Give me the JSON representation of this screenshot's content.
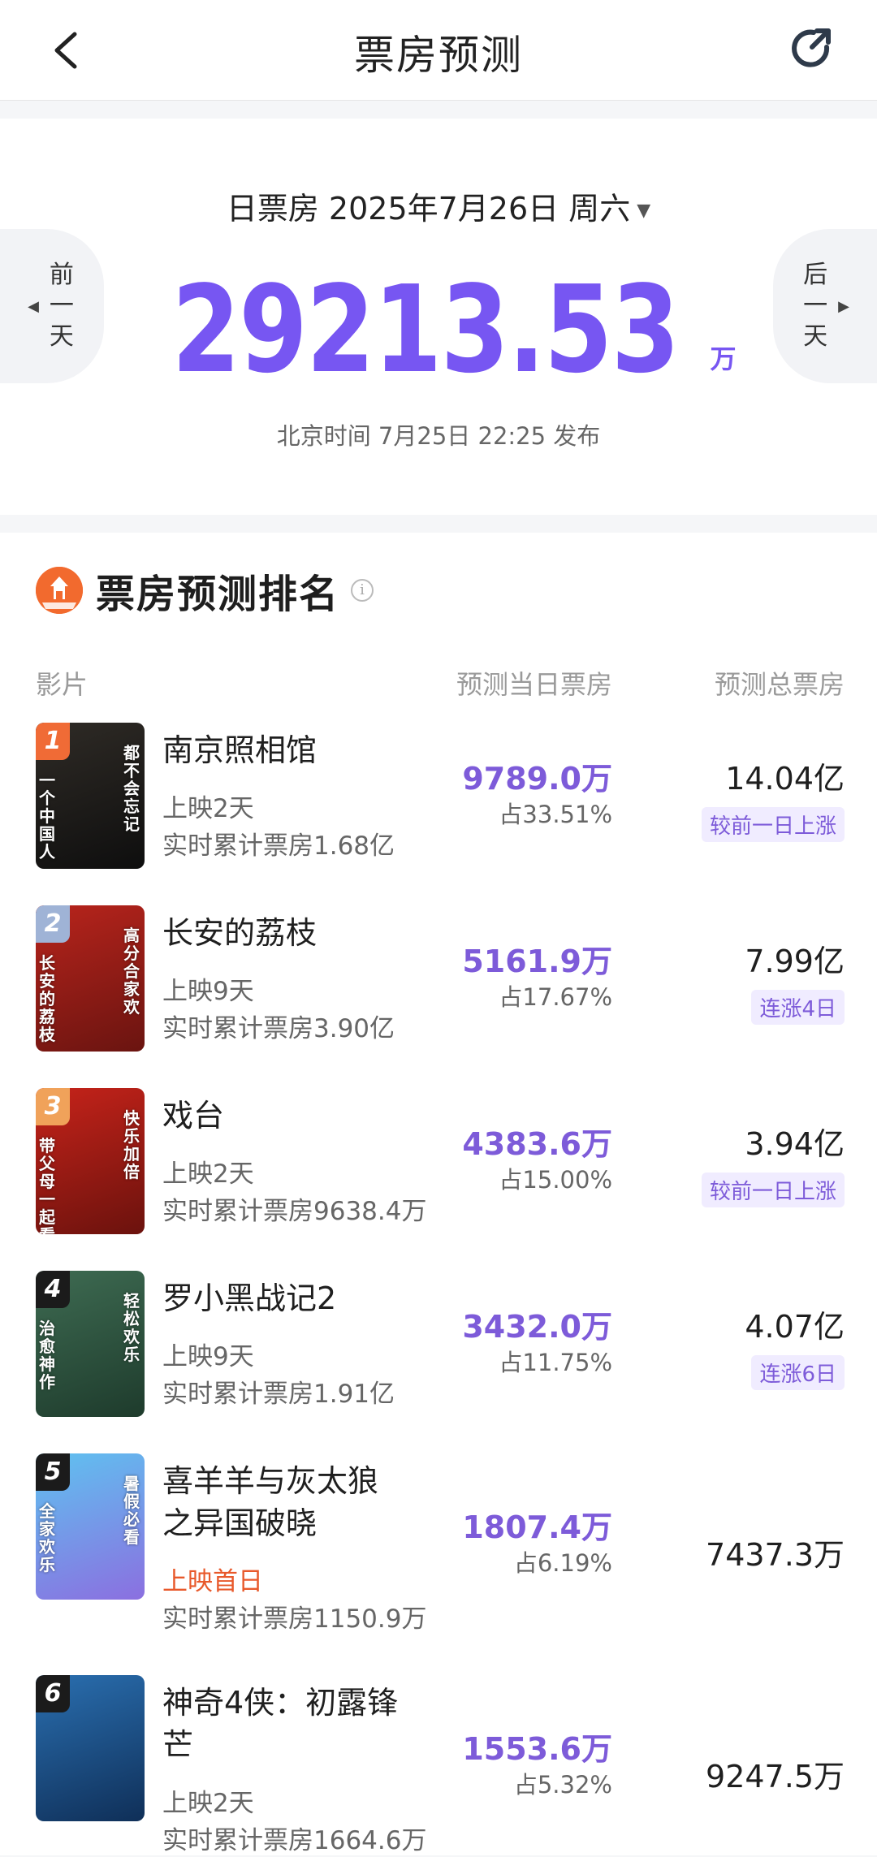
{
  "nav": {
    "title": "票房预测"
  },
  "daily": {
    "heading": "日票房 2025年7月26日 周六",
    "amount": "29213.53",
    "unit": "万",
    "publish": "北京时间 7月25日 22:25 发布",
    "prev_label": [
      "前",
      "一",
      "天"
    ],
    "next_label": [
      "后",
      "一",
      "天"
    ]
  },
  "ranking": {
    "title": "票房预测排名",
    "columns": {
      "film": "影片",
      "daily": "预测当日票房",
      "total": "预测总票房"
    },
    "movies": [
      {
        "rank": "1",
        "title_lines": [
          "南京照相馆"
        ],
        "days": "上映2天",
        "cumulative": "实时累计票房1.68亿",
        "daily": "9789.0万",
        "share": "占33.51%",
        "total": "14.04亿",
        "tag": "较前一日上涨",
        "badge_color": "#f06b36",
        "poster_colors": [
          "#2f2b26",
          "#0e0e0e"
        ],
        "poster_texts": [
          "都不会忘记",
          "一个中国人"
        ]
      },
      {
        "rank": "2",
        "title_lines": [
          "长安的荔枝"
        ],
        "days": "上映9天",
        "cumulative": "实时累计票房3.90亿",
        "daily": "5161.9万",
        "share": "占17.67%",
        "total": "7.99亿",
        "tag": "连涨4日",
        "badge_color": "#9fb3d6",
        "poster_colors": [
          "#b8241c",
          "#6a1410"
        ],
        "poster_texts": [
          "高分合家欢",
          "长安的荔枝"
        ]
      },
      {
        "rank": "3",
        "title_lines": [
          "戏台"
        ],
        "days": "上映2天",
        "cumulative": "实时累计票房9638.4万",
        "daily": "4383.6万",
        "share": "占15.00%",
        "total": "3.94亿",
        "tag": "较前一日上涨",
        "badge_color": "#f0a25a",
        "poster_colors": [
          "#c6231a",
          "#6b120d"
        ],
        "poster_texts": [
          "快乐加倍",
          "带父母一起看"
        ]
      },
      {
        "rank": "4",
        "title_lines": [
          "罗小黑战记2"
        ],
        "days": "上映9天",
        "cumulative": "实时累计票房1.91亿",
        "daily": "3432.0万",
        "share": "占11.75%",
        "total": "4.07亿",
        "tag": "连涨6日",
        "badge_color": "#1b1b1b",
        "poster_colors": [
          "#3e6b52",
          "#1e3b2c"
        ],
        "poster_texts": [
          "轻松欢乐",
          "治愈神作"
        ]
      },
      {
        "rank": "5",
        "title_lines": [
          "喜羊羊与灰太狼",
          "之异国破晓"
        ],
        "days": "上映首日",
        "cumulative": "实时累计票房1150.9万",
        "daily": "1807.4万",
        "share": "占6.19%",
        "total": "7437.3万",
        "tag": "",
        "badge_color": "#1b1b1b",
        "poster_colors": [
          "#5fc2f0",
          "#8b6fe0"
        ],
        "poster_texts": [
          "暑假必看",
          "全家欢乐"
        ]
      },
      {
        "rank": "6",
        "title_lines": [
          "神奇4侠：初露锋",
          "芒"
        ],
        "days": "上映2天",
        "cumulative": "实时累计票房1664.6万",
        "daily": "1553.6万",
        "share": "占5.32%",
        "total": "9247.5万",
        "tag": "",
        "badge_color": "#1b1b1b",
        "poster_colors": [
          "#2a6fb0",
          "#0f2f58"
        ],
        "poster_texts": [
          "",
          ""
        ]
      }
    ]
  },
  "colors": {
    "accent": "#7756f2",
    "tag_bg": "#f0ecff",
    "first_day": "#e8592b",
    "logo": "#f26a2e"
  },
  "icons": {
    "back": "back-chevron-icon",
    "share": "share-icon",
    "info": "info-icon",
    "logo": "box-office-logo-icon"
  }
}
